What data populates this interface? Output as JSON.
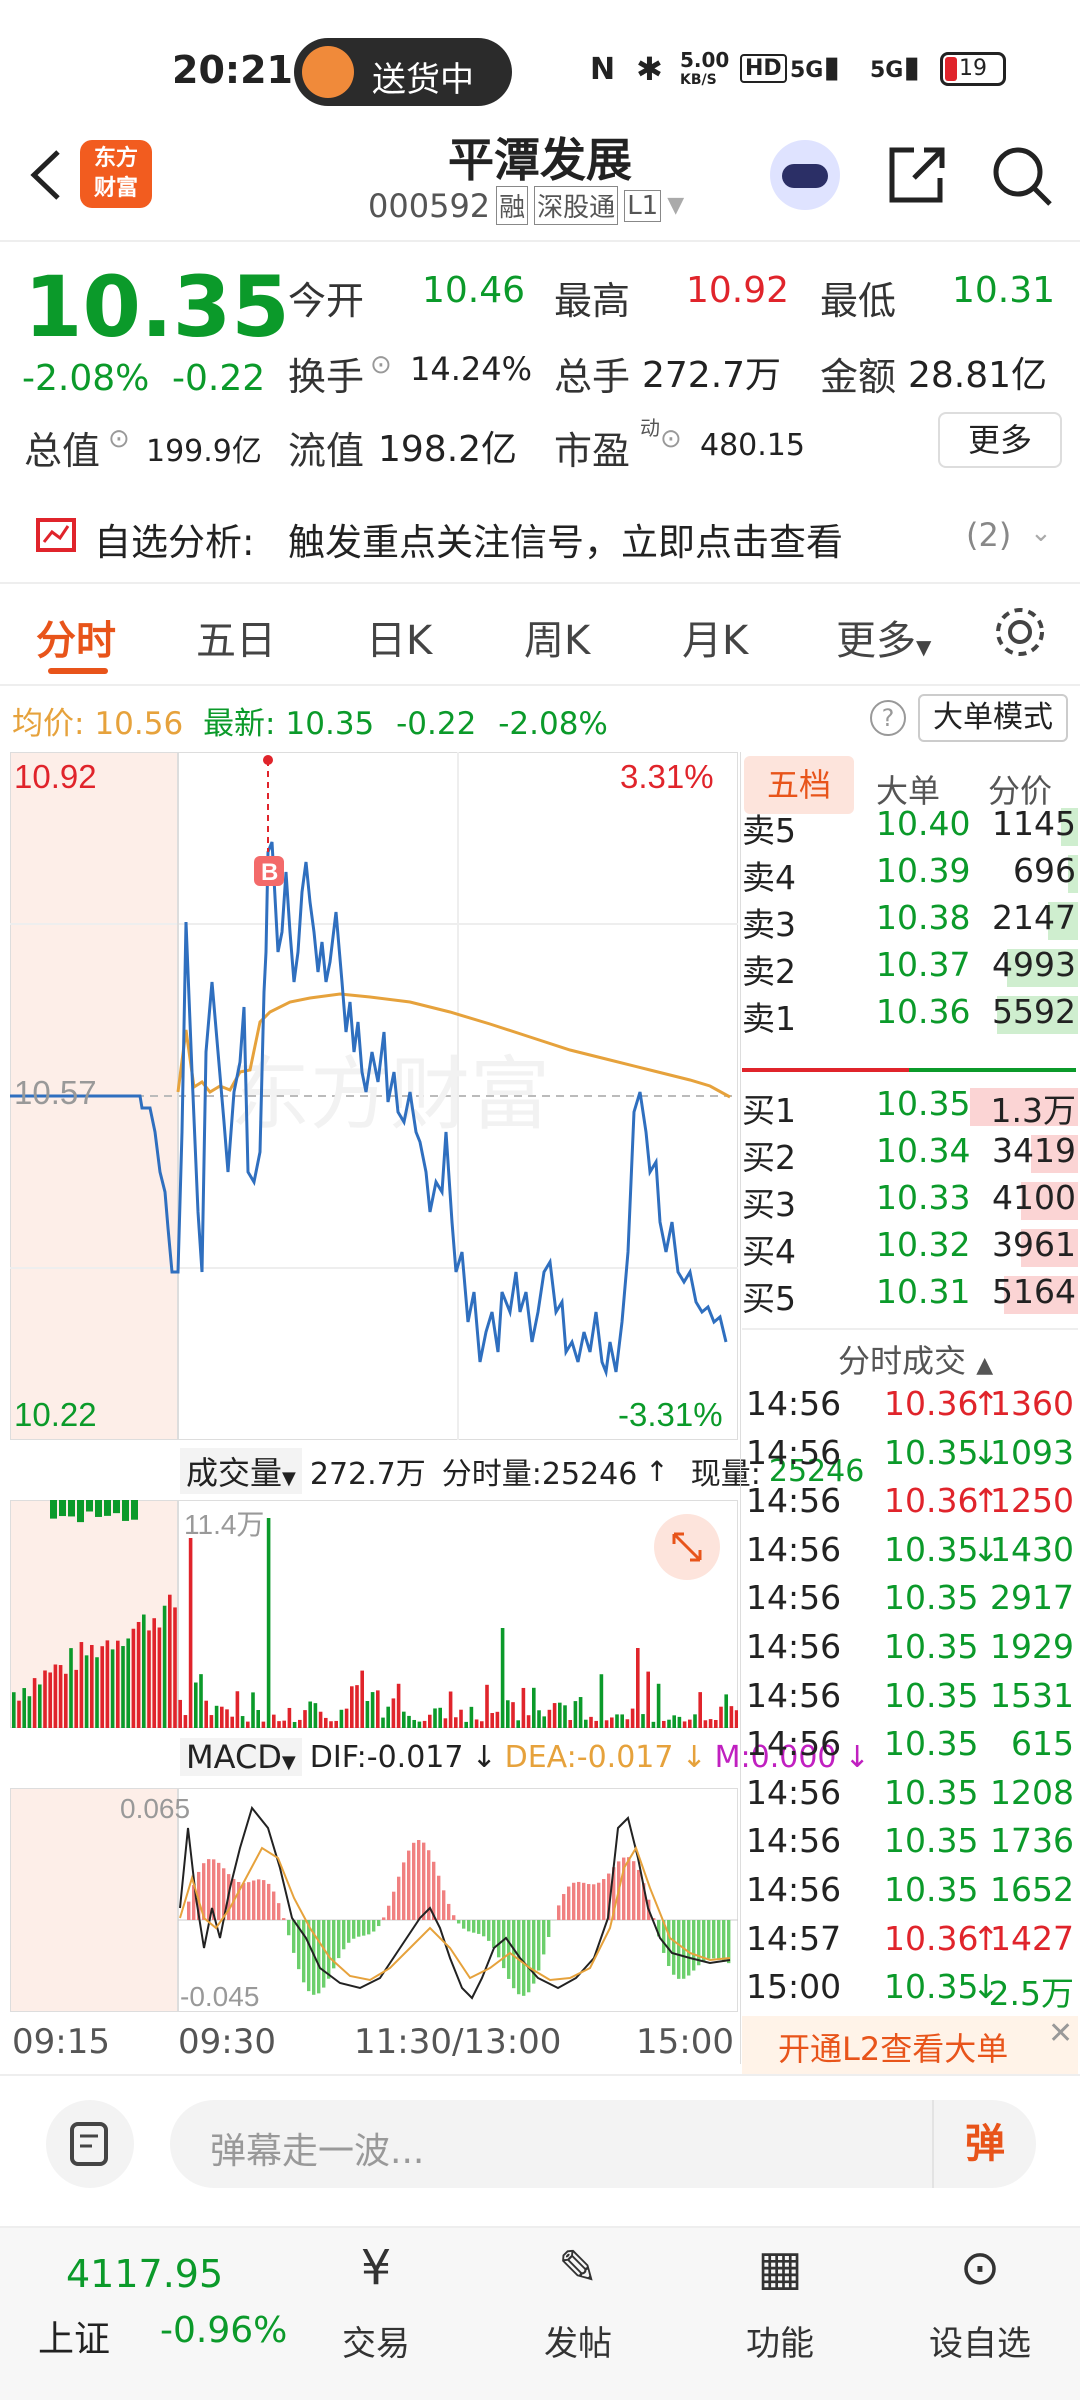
{
  "status_bar": {
    "time": "20:21",
    "pill_text": "送货中",
    "net_speed": "5.00",
    "net_unit": "KB/S",
    "hd": "HD",
    "sig1": "5G",
    "sig2": "5G",
    "battery": "19"
  },
  "header": {
    "logo_line1": "东方",
    "logo_line2": "财富",
    "stock_name": "平潭发展",
    "stock_code": "000592",
    "tag_rong": "融",
    "tag_sgt": "深股通",
    "tag_level": "L1"
  },
  "quote": {
    "price": "10.35",
    "change_pct": "-2.08%",
    "change_abs": "-0.22",
    "open_label": "今开",
    "open": "10.46",
    "high_label": "最高",
    "high": "10.92",
    "low_label": "最低",
    "low": "10.31",
    "turnover_label": "换手",
    "turnover": "14.24%",
    "volume_label": "总手",
    "volume": "272.7万",
    "amount_label": "金额",
    "amount": "28.81亿",
    "mktcap_label": "总值",
    "mktcap": "199.9亿",
    "float_label": "流值",
    "float": "198.2亿",
    "pe_label": "市盈",
    "pe_sup": "动",
    "pe": "480.15",
    "more": "更多"
  },
  "analysis": {
    "label": "自选分析:",
    "text": "触发重点关注信号，立即点击查看",
    "count": "(2)"
  },
  "tabs": [
    "分时",
    "五日",
    "日K",
    "周K",
    "月K",
    "更多"
  ],
  "chart_info": {
    "avg_label": "均价:",
    "avg": "10.56",
    "last_label": "最新:",
    "last": "10.35",
    "chg": "-0.22",
    "pct": "-2.08%",
    "mode_button": "大单模式"
  },
  "chart_labels": {
    "top_price": "10.92",
    "top_pct": "3.31%",
    "mid_price": "10.57",
    "bottom_price": "10.22",
    "bottom_pct": "-3.31%",
    "marker": "B"
  },
  "volume_panel": {
    "label": "成交量",
    "total": "272.7万",
    "minute_vol": "分时量:25246",
    "current_label": "现量:",
    "current": "25246",
    "max": "11.4万"
  },
  "macd_panel": {
    "label": "MACD",
    "dif": "DIF:-0.017",
    "dea": "DEA:-0.017",
    "m": "M:0.000",
    "top": "0.065",
    "bottom": "-0.045"
  },
  "time_axis": [
    "09:15",
    "09:30",
    "11:30/13:00",
    "15:00"
  ],
  "order_book": {
    "tabs": [
      "五档",
      "大单",
      "分价"
    ],
    "asks": [
      {
        "label": "卖5",
        "price": "10.40",
        "vol": "1145",
        "fill": 0.05
      },
      {
        "label": "卖4",
        "price": "10.39",
        "vol": "696",
        "fill": 0.03
      },
      {
        "label": "卖3",
        "price": "10.38",
        "vol": "2147",
        "fill": 0.09
      },
      {
        "label": "卖2",
        "price": "10.37",
        "vol": "4993",
        "fill": 0.21
      },
      {
        "label": "卖1",
        "price": "10.36",
        "vol": "5592",
        "fill": 0.24
      }
    ],
    "bids": [
      {
        "label": "买1",
        "price": "10.35",
        "vol": "1.3万",
        "fill": 0.32
      },
      {
        "label": "买2",
        "price": "10.34",
        "vol": "3419",
        "fill": 0.14
      },
      {
        "label": "买3",
        "price": "10.33",
        "vol": "4100",
        "fill": 0.17
      },
      {
        "label": "买4",
        "price": "10.32",
        "vol": "3961",
        "fill": 0.17
      },
      {
        "label": "买5",
        "price": "10.31",
        "vol": "5164",
        "fill": 0.22
      }
    ]
  },
  "ticks": {
    "title": "分时成交",
    "rows": [
      {
        "time": "14:56",
        "price": "10.36",
        "dir": "up",
        "vol": "1360"
      },
      {
        "time": "14:56",
        "price": "10.35",
        "dir": "down",
        "vol": "1093"
      },
      {
        "time": "14:56",
        "price": "10.36",
        "dir": "up",
        "vol": "1250"
      },
      {
        "time": "14:56",
        "price": "10.35",
        "dir": "down",
        "vol": "1430"
      },
      {
        "time": "14:56",
        "price": "10.35",
        "dir": "",
        "vol": "2917"
      },
      {
        "time": "14:56",
        "price": "10.35",
        "dir": "",
        "vol": "1929"
      },
      {
        "time": "14:56",
        "price": "10.35",
        "dir": "",
        "vol": "1531"
      },
      {
        "time": "14:56",
        "price": "10.35",
        "dir": "",
        "vol": "615"
      },
      {
        "time": "14:56",
        "price": "10.35",
        "dir": "",
        "vol": "1208"
      },
      {
        "time": "14:56",
        "price": "10.35",
        "dir": "",
        "vol": "1736"
      },
      {
        "time": "14:56",
        "price": "10.35",
        "dir": "",
        "vol": "1652"
      },
      {
        "time": "14:57",
        "price": "10.36",
        "dir": "up",
        "vol": "1427"
      },
      {
        "time": "15:00",
        "price": "10.35",
        "dir": "down",
        "vol": "2.5万"
      }
    ]
  },
  "l2_banner": "开通L2查看大单",
  "comment_placeholder": "弹幕走一波...",
  "danmu_button": "弹",
  "bottom_nav": {
    "index_value": "4117.95",
    "index_name": "上证",
    "index_change": "-0.96%",
    "items": [
      "交易",
      "发帖",
      "功能",
      "设自选"
    ]
  },
  "colors": {
    "up": "#e0242b",
    "down": "#0b9a2a",
    "price_line": "#2f6fbf",
    "avg_line": "#e6a23c",
    "accent": "#f25c1f"
  }
}
